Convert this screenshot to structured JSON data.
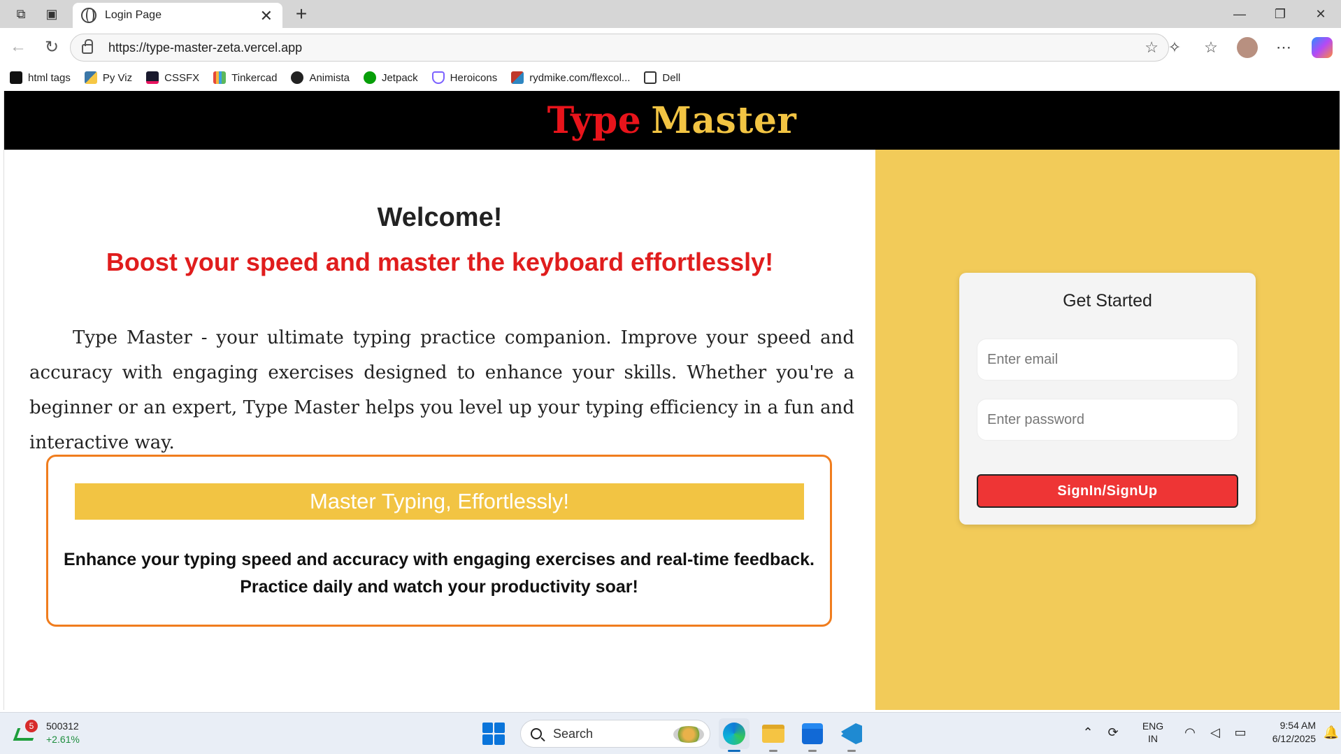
{
  "browser": {
    "tab_title": "Login Page",
    "url": "https://type-master-zeta.vercel.app",
    "bookmarks": [
      {
        "label": "html tags",
        "icon": "mdn-icon",
        "color": "#111111"
      },
      {
        "label": "Py Viz",
        "icon": "python-icon",
        "color": "#3b77a8"
      },
      {
        "label": "CSSFX",
        "icon": "cssfx-icon",
        "color": "#1a1a2e"
      },
      {
        "label": "Tinkercad",
        "icon": "tinkercad-icon",
        "color": "#e6493a"
      },
      {
        "label": "Animista",
        "icon": "animista-icon",
        "color": "#222222"
      },
      {
        "label": "Jetpack",
        "icon": "jetpack-icon",
        "color": "#069e08"
      },
      {
        "label": "Heroicons",
        "icon": "heroicons-icon",
        "color": "#7b61ff"
      },
      {
        "label": "rydmike.com/flexcol...",
        "icon": "flexcolor-icon",
        "color": "#c0392b"
      },
      {
        "label": "Dell",
        "icon": "folder-icon",
        "color": "#ffffff"
      }
    ]
  },
  "header": {
    "title_part1": "Type",
    "title_part2": "Master",
    "color_part1": "#e8141b",
    "color_part2": "#f2c443"
  },
  "hero": {
    "welcome": "Welcome!",
    "tagline": "Boost your speed and master the keyboard effortlessly!",
    "intro": "Type Master - your ultimate typing practice companion. Improve your speed and accuracy with engaging exercises designed to enhance your skills. Whether you're a beginner or an expert, Type Master helps you level up your typing efficiency in a fun and interactive way."
  },
  "feature": {
    "heading": "Master Typing, Effortlessly!",
    "description_line1": "Enhance your typing speed and accuracy with engaging exercises and real-time feedback.",
    "description_line2": "Practice daily and watch your productivity soar!"
  },
  "login": {
    "title": "Get Started",
    "email_placeholder": "Enter email",
    "password_placeholder": "Enter password",
    "submit_label": "SignIn/SignUp"
  },
  "taskbar": {
    "stock_code": "500312",
    "stock_change": "+2.61%",
    "stock_badge": "5",
    "search_label": "Search",
    "lang_line1": "ENG",
    "lang_line2": "IN",
    "time": "9:54 AM",
    "date": "6/12/2025"
  }
}
